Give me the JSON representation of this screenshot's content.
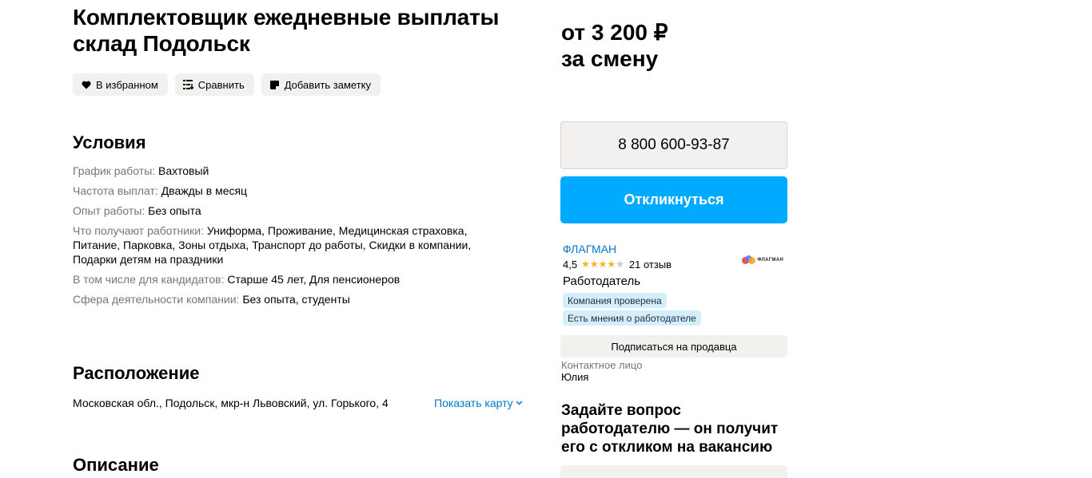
{
  "vacancy": {
    "title": "Комплектовщик ежедневные выплаты склад Подольск",
    "price_line1": "от 3 200 ₽",
    "price_line2": "за смену"
  },
  "actions": [
    {
      "label": "В избранном",
      "icon": "heart-icon"
    },
    {
      "label": "Сравнить",
      "icon": "compare-icon"
    },
    {
      "label": "Добавить заметку",
      "icon": "note-icon"
    }
  ],
  "conditions": {
    "heading": "Условия",
    "rows": [
      {
        "label": "График работы:",
        "value": "Вахтовый"
      },
      {
        "label": "Частота выплат:",
        "value": "Дважды в месяц"
      },
      {
        "label": "Опыт работы:",
        "value": "Без опыта"
      },
      {
        "label": "Что получают работники:",
        "value": "Униформа, Проживание, Медицинская страховка, Питание, Парковка, Зоны отдыха, Транспорт до работы, Скидки в компании, Подарки детям на праздники"
      },
      {
        "label": "В том числе для кандидатов:",
        "value": "Старше 45 лет, Для пенсионеров"
      },
      {
        "label": "Сфера деятельности компании:",
        "value": "Без опыта, студенты"
      }
    ]
  },
  "location": {
    "heading": "Расположение",
    "address": "Московская обл., Подольск, мкр-н Львовский, ул. Горького, 4",
    "show_map": "Показать карту"
  },
  "description": {
    "heading": "Описание"
  },
  "sidebar": {
    "phone": "8 800 600-93-87",
    "respond_label": "Откликнуться",
    "seller_name": "ФЛАГМАН",
    "rating_value": "4,5",
    "rating_stars": 4.5,
    "reviews": "21 отзыв",
    "seller_type": "Работодатель",
    "logo_text": "ФЛАГМАН",
    "badges": [
      "Компания проверена",
      "Есть мнения о работодателе"
    ],
    "subscribe_label": "Подписаться на продавца",
    "contact_label": "Контактное лицо",
    "contact_name": "Юлия",
    "ask_title": "Задайте вопрос работодателю — он получит его с откликом на вакансию"
  },
  "colors": {
    "accent_blue": "#00aaff",
    "link_blue": "#0077c8",
    "button_bg": "#f2f1f0",
    "badge_bg": "#d5eefc",
    "star": "#ffb021"
  }
}
